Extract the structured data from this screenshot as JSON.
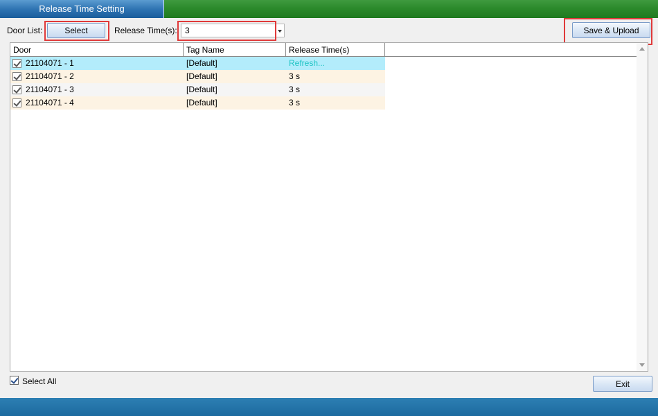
{
  "window": {
    "tab_title": "Release Time Setting"
  },
  "toolbar": {
    "door_list_label": "Door List:",
    "select_label": "Select",
    "release_time_label": "Release Time(s):",
    "release_time_value": "3",
    "save_upload_label": "Save & Upload"
  },
  "table": {
    "columns": [
      "Door",
      "Tag Name",
      "Release Time(s)"
    ],
    "rows": [
      {
        "door": "21104071 - 1",
        "tag": "[Default]",
        "release": "Refresh..."
      },
      {
        "door": "21104071 - 2",
        "tag": "[Default]",
        "release": "3 s"
      },
      {
        "door": "21104071 - 3",
        "tag": "[Default]",
        "release": "3 s"
      },
      {
        "door": "21104071 - 4",
        "tag": "[Default]",
        "release": "3 s"
      }
    ]
  },
  "footer": {
    "select_all_label": "Select All",
    "exit_label": "Exit"
  },
  "colors": {
    "selected_row": "#b3ecfb",
    "alt_row": "#fdf3e3",
    "plain_row": "#f5f5f5",
    "refresh_text": "#1ec4c4",
    "highlight_box": "#e03a3a"
  }
}
